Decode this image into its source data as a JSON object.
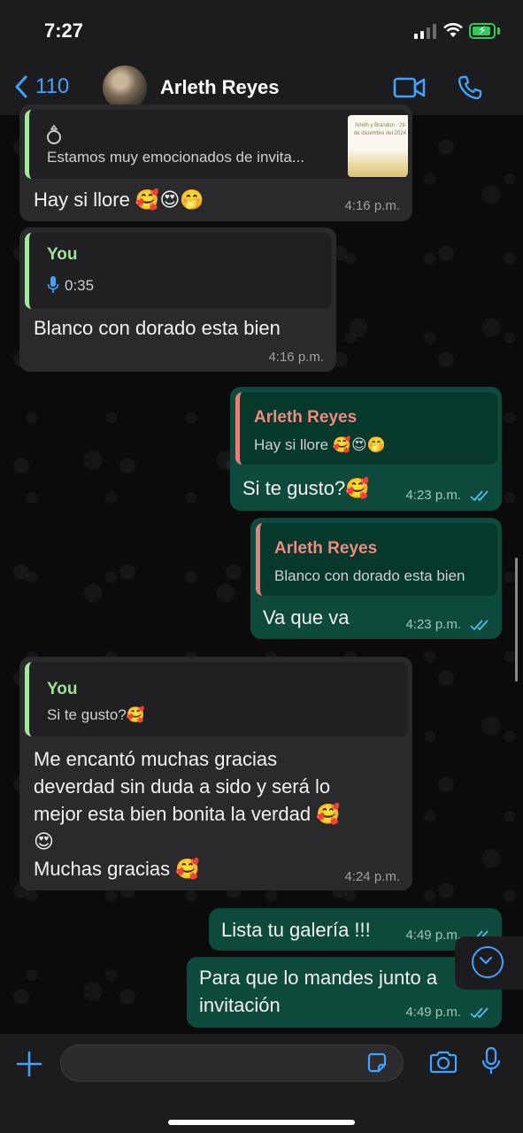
{
  "status": {
    "time": "7:27"
  },
  "header": {
    "back_count": "110",
    "contact_name": "Arleth Reyes"
  },
  "messages": [
    {
      "id": "m1",
      "dir": "in",
      "quote_icon": "ring-icon",
      "quote_text": "Estamos muy emocionados de invita...",
      "thumb_text": "Arleth y Brandon · 28 de diciembre del 2024",
      "text": "Hay si llore 🥰😍🤭",
      "time": "4:16 p.m."
    },
    {
      "id": "m2",
      "dir": "in",
      "quote_author": "You",
      "quote_voice": "0:35",
      "text": "Blanco con dorado esta bien",
      "time": "4:16 p.m."
    },
    {
      "id": "m3",
      "dir": "out",
      "quote_author": "Arleth Reyes",
      "quote_text": "Hay si llore 🥰😍🤭",
      "text": "Si te gusto?🥰",
      "time": "4:23 p.m."
    },
    {
      "id": "m4",
      "dir": "out",
      "quote_author": "Arleth Reyes",
      "quote_text": "Blanco con dorado esta bien",
      "text": "Va que va",
      "time": "4:23 p.m."
    },
    {
      "id": "m5",
      "dir": "in",
      "quote_author": "You",
      "quote_text": "Si te gusto?🥰",
      "lines": [
        "Me encantó  muchas gracias",
        "deverdad  sin duda a sido y será lo",
        "mejor  esta bien bonita la verdad 🥰",
        "😍",
        "Muchas gracias 🥰"
      ],
      "time": "4:24 p.m."
    },
    {
      "id": "m6",
      "dir": "out",
      "text": "Lista tu galería !!!",
      "time": "4:49 p.m."
    },
    {
      "id": "m7",
      "dir": "out",
      "lines": [
        "Para que lo mandes junto a",
        "invitación"
      ],
      "time": "4:49 p.m."
    }
  ],
  "composer": {
    "placeholder": ""
  },
  "colors": {
    "accent": "#3fa3ff",
    "incoming_bubble": "#2a2a2c",
    "outgoing_bubble": "#0d4a3c",
    "you_author": "#9fe29a",
    "contact_author": "#ef8a80",
    "read_ticks": "#53bdeb"
  },
  "icons": [
    "back-chevron-icon",
    "video-call-icon",
    "phone-icon",
    "ring-icon",
    "mic-icon",
    "double-check-icon",
    "scroll-down-icon",
    "plus-icon",
    "sticker-icon",
    "camera-icon"
  ]
}
